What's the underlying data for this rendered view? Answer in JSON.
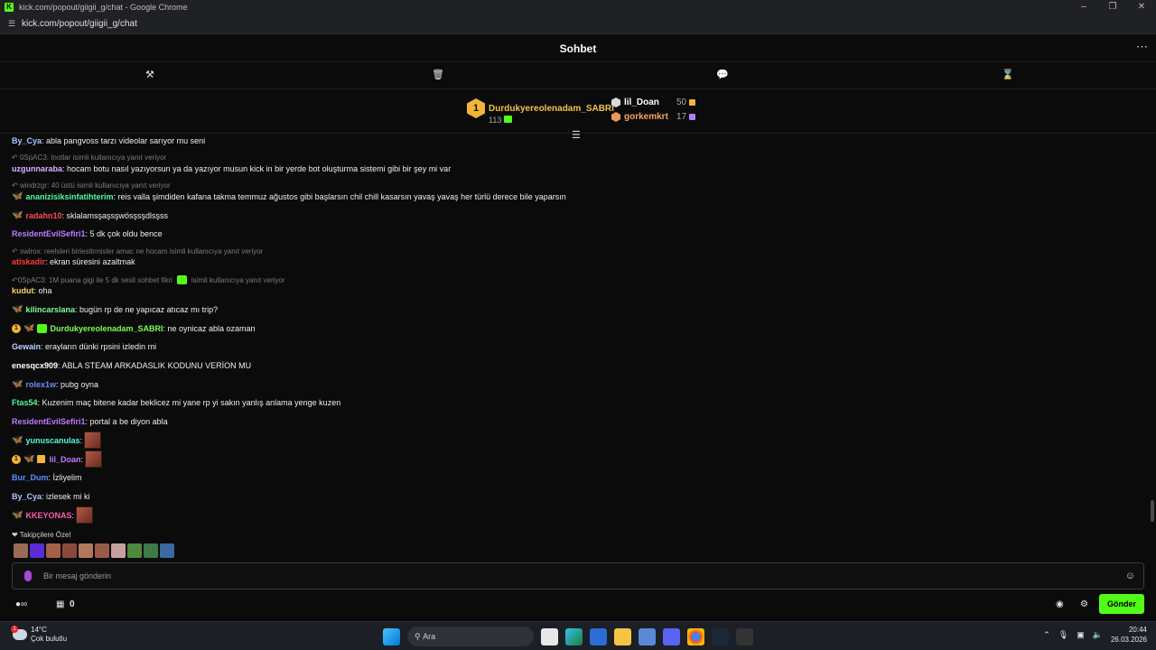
{
  "browser": {
    "title": "kick.com/popout/giigii_g/chat - Google Chrome",
    "url": "kick.com/popout/giigii_g/chat"
  },
  "chat_header": {
    "title": "Sohbet"
  },
  "leaderboard": {
    "first": {
      "rank": "1",
      "name": "Durdukyereolenadam_SABRI",
      "count": "113"
    },
    "others": [
      {
        "name": "lil_Doan",
        "count": "50",
        "color": "#ffffff",
        "coin": "#f2b43a"
      },
      {
        "name": "gorkemkrt",
        "count": "17",
        "color": "#f2a65a",
        "coin": "#b47cf2"
      }
    ]
  },
  "messages": [
    {
      "user": "By_Cya",
      "color": "#a9c8ff",
      "text": ": abla pangvoss tarzı videolar sarıyor mu seni"
    },
    {
      "reply": "0SpAC3: Inotlar isimli kullanıcıya yanıt veriyor"
    },
    {
      "user": "uzgunnaraba",
      "color": "#d8b2ff",
      "text": ": hocam botu nasıl yazıyorsun ya da yazıyor musun kick in bir yerde bot oluşturma sistemi gibi bir şey mi var"
    },
    {
      "reply": "windrzgr: 40 üstü isimli kullanıcıya yanıt veriyor"
    },
    {
      "user": "ananizisiksinfatihterim",
      "color": "#53fc9c",
      "text": ": reis valla şimdiden kafana takma temmuz ağustos gibi başlarsın chil chill kasarsın yavaş yavaş her türlü derece bile yaparsın"
    },
    {
      "user": "radahn10",
      "color": "#ff4d4d",
      "text": ": sklalamsşaşsşwösşsşdlsşss"
    },
    {
      "user": "ResidentEvilSefiri1",
      "color": "#b97cff",
      "text": ": 5 dk çok oldu bence"
    },
    {
      "reply": "swirox: reelsleri birlestirmisler amac ne hocam isimli kullanıcıya yanıt veriyor"
    },
    {
      "user": "atiskadir",
      "color": "#ff3b3b",
      "text": ": ekran süresini azaltmak"
    },
    {
      "reply": "0SpAC3: 1M puana gigi ile 5 dk sesli sohbet fikri",
      "reply2": "isimli kullanıcıya yanıt veriyor"
    },
    {
      "user": "kudut",
      "color": "#ffd36b",
      "text": ": oha"
    },
    {
      "user": "kilincarslana",
      "color": "#7cff9a",
      "text": ": bugün rp de ne yapıcaz atıcaz mı trip?"
    },
    {
      "user": "Durdukyereolenadam_SABRI",
      "color": "#7cff4d",
      "text": ": ne oynicaz abla ozaman"
    },
    {
      "user": "Gewain",
      "color": "#b8d4ff",
      "text": ": erayların dünki rpsini izledin mi"
    },
    {
      "user": "enesqcx909",
      "color": "#ffffff",
      "text": ": ABLA STEAM ARKADASLIK KODUNU VERİON MU"
    },
    {
      "user": "rolex1w",
      "color": "#6f8dff",
      "text": ": pubg oyna"
    },
    {
      "user": "Ftas54",
      "color": "#53fc9c",
      "text": ": Kuzenim maç bitene kadar beklicez mi yane rp yi sakın yanlış anlama yenge kuzen"
    },
    {
      "user": "ResidentEvilSefiri1",
      "color": "#b97cff",
      "text": ": portal a be diyon abla"
    },
    {
      "user": "yunuscanulas",
      "color": "#53fcd2",
      "text": ":"
    },
    {
      "user": "lil_Doan",
      "color": "#c07cff",
      "text": ":"
    },
    {
      "user": "Bur_Dum",
      "color": "#5b8cff",
      "text": ": İzliyelim"
    },
    {
      "user": "By_Cya",
      "color": "#a9c8ff",
      "text": ": izlesek mi ki"
    },
    {
      "user": "KKEYONAS",
      "color": "#ff5ca8",
      "text": ":"
    }
  ],
  "favorites": {
    "label": "Takipçilere Özel"
  },
  "input": {
    "placeholder": "Bir mesaj gönderin"
  },
  "bottom": {
    "points": "0",
    "send_label": "Gönder"
  },
  "taskbar": {
    "temp": "14°C",
    "weather": "Çok bulutlu",
    "weather_alert": "1",
    "search": "Ara",
    "time": "20:44",
    "date": "26.03.2026"
  }
}
